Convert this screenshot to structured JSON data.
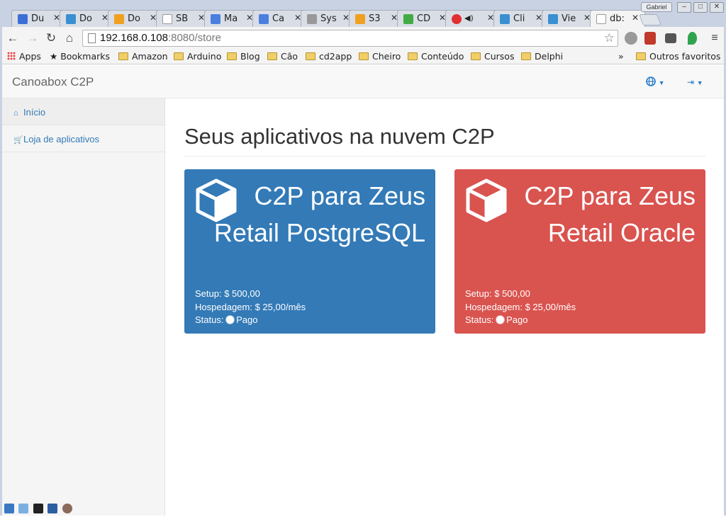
{
  "browser": {
    "tabs": [
      {
        "title": "Du",
        "favicon_color": "#3b6fd6"
      },
      {
        "title": "Do",
        "favicon_color": "#3a8fd0"
      },
      {
        "title": "Do",
        "favicon_color": "#f0a020"
      },
      {
        "title": "SB",
        "favicon_color": "#cccccc"
      },
      {
        "title": "Ma",
        "favicon_color": "#4a7fe0"
      },
      {
        "title": "Ca",
        "favicon_color": "#4a7fe0"
      },
      {
        "title": "Sys",
        "favicon_color": "#888888"
      },
      {
        "title": "S3",
        "favicon_color": "#f0a020"
      },
      {
        "title": "CD",
        "favicon_color": "#44aa44"
      },
      {
        "title": "",
        "favicon_color": "#e03030"
      },
      {
        "title": "Cli",
        "favicon_color": "#3a8fd0"
      },
      {
        "title": "Vie",
        "favicon_color": "#3a8fd0"
      },
      {
        "title": "db:",
        "favicon_color": "#ffffff"
      }
    ],
    "profile_name": "Gabriel",
    "url_host": "192.168.0.108",
    "url_rest": ":8080/store",
    "bookmarks": [
      {
        "label": "Apps",
        "icon": "apps-grid-icon"
      },
      {
        "label": "Bookmarks",
        "icon": "star-icon"
      },
      {
        "label": "Amazon",
        "icon": "folder-icon"
      },
      {
        "label": "Arduino",
        "icon": "folder-icon"
      },
      {
        "label": "Blog",
        "icon": "folder-icon"
      },
      {
        "label": "Cão",
        "icon": "folder-icon"
      },
      {
        "label": "cd2app",
        "icon": "folder-icon"
      },
      {
        "label": "Cheiro",
        "icon": "folder-icon"
      },
      {
        "label": "Conteúdo",
        "icon": "folder-icon"
      },
      {
        "label": "Cursos",
        "icon": "folder-icon"
      },
      {
        "label": "Delphi",
        "icon": "folder-icon"
      }
    ],
    "overflow_label": "»",
    "other_bookmarks": "Outros favoritos"
  },
  "app": {
    "brand": "Canoabox C2P",
    "sidebar": [
      {
        "label": "Início",
        "icon": "home-icon"
      },
      {
        "label": "Loja de aplicativos",
        "icon": "shopping-cart-icon"
      }
    ],
    "page_title": "Seus aplicativos na nuvem C2P",
    "cards": [
      {
        "name": "C2P para Zeus Retail PostgreSQL",
        "setup_label": "Setup:",
        "setup_value": "$ 500,00",
        "hosting_label": "Hospedagem:",
        "hosting_value": "$ 25,00/mês",
        "status_label": "Status:",
        "status_value": "Pago",
        "color": "#337ab7"
      },
      {
        "name": "C2P para Zeus Retail Oracle",
        "setup_label": "Setup:",
        "setup_value": "$ 500,00",
        "hosting_label": "Hospedagem:",
        "hosting_value": "$ 25,00/mês",
        "status_label": "Status:",
        "status_value": "Pago",
        "color": "#d9534f"
      }
    ]
  }
}
